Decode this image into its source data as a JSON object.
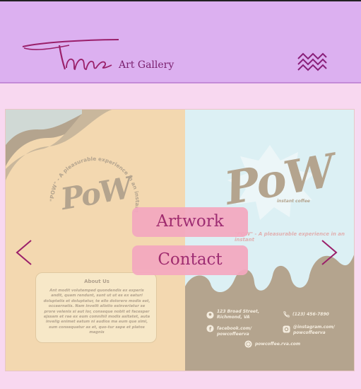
{
  "colors": {
    "header_bg": "#dcb0f0",
    "page_bg": "#f8d8f0",
    "accent": "#9a1f6a",
    "button_bg": "#f4a8c0"
  },
  "header": {
    "logo_text": "Tme",
    "subtitle": "Art Gallery",
    "menu_icon": "zigzag-menu-icon"
  },
  "nav": {
    "artwork": "Artwork",
    "contact": "Contact"
  },
  "slider": {
    "prev_icon": "chevron-left-icon",
    "next_icon": "chevron-right-icon"
  },
  "slide": {
    "left_brand": "PoW",
    "circle_text": "\"POW\" - A pleasurable experience in an instant",
    "about_title": "About Us",
    "about_text": "Ant modit volutemped quondendis ex experis andit, quam rendunt, sunt ut ut es ex eaturi doluptatis et doluptatur, te ello dolorero modis est, occaernatis. Nam invelit alistio esinveriatur se prore velenis si aut lor, conseque nobit et facesper ejssam et rae ex eum comnihil modis asitatet, auta invelig enimet eatum ni audios ma eum que simi, sum consequatur as et, quo-tur sape et platos magnis",
    "right_brand": "PoW",
    "right_sub": "instant coffee",
    "tagline": "\"POW\" - A pleasurable experience in an instant",
    "address": "123 Broad Street,\nRichmond, VA",
    "phone": "(123) 456-7890",
    "facebook": "facebook.com/\npowcoffeerva",
    "instagram": "@instagram.com/\npowcoffeerva",
    "website": "powcoffee.rva.com"
  }
}
